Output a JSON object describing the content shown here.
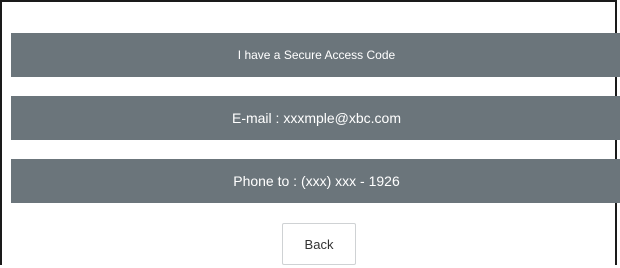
{
  "options": {
    "secure_code": "I have a Secure Access Code",
    "email": "E-mail : xxxmple@xbc.com",
    "phone": "Phone to : (xxx) xxx - 1926"
  },
  "actions": {
    "back_label": "Back"
  },
  "colors": {
    "option_bg": "#6b757b",
    "option_text": "#ffffff",
    "page_bg": "#ffffff"
  }
}
